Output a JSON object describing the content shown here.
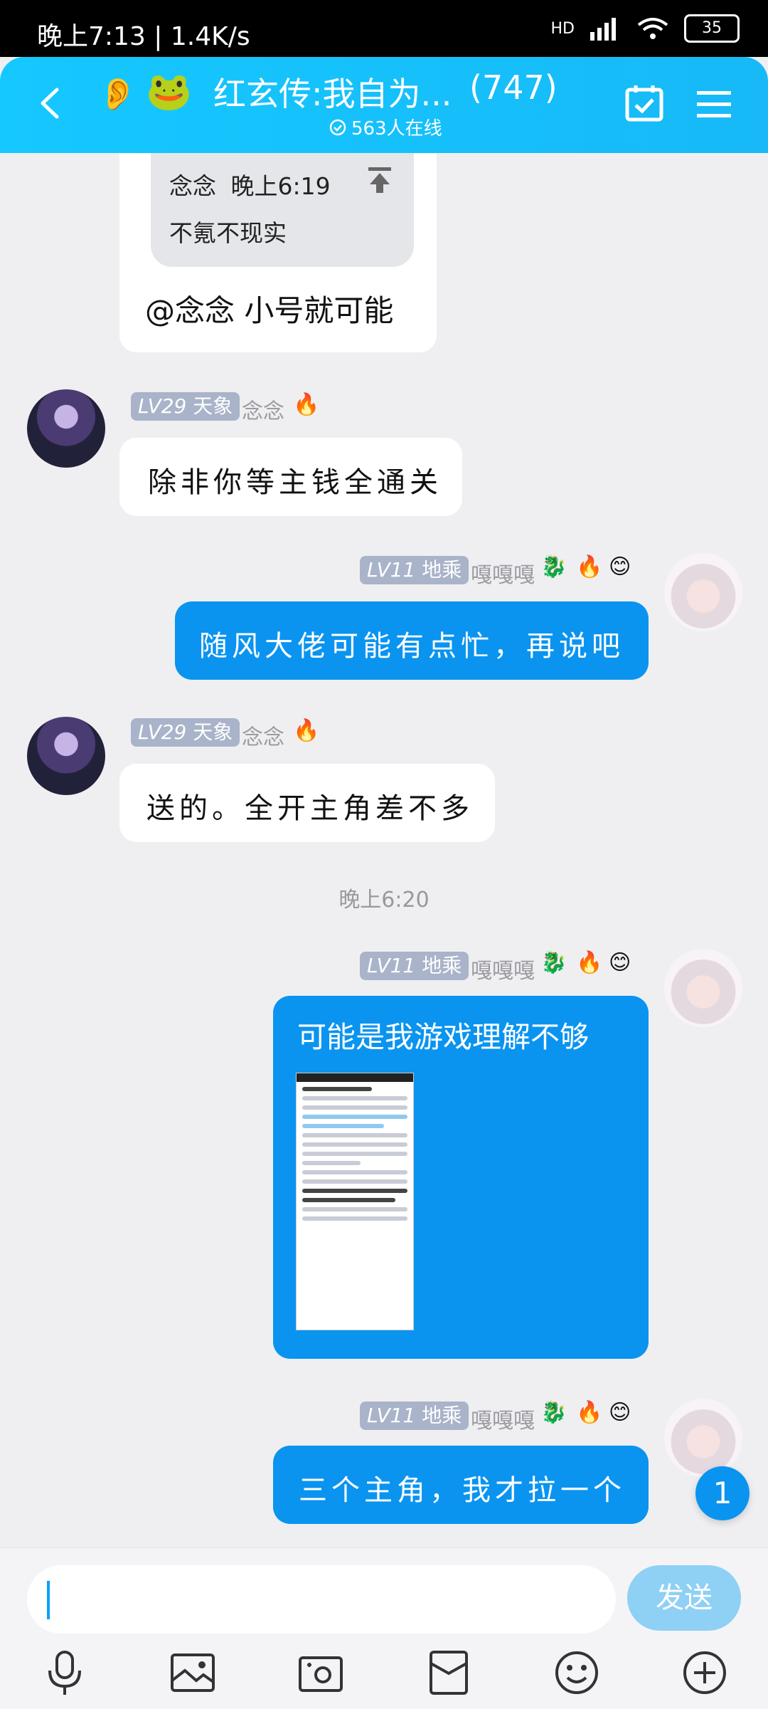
{
  "status_bar": {
    "time_speed": "晚上7:13 | 1.4K/s",
    "signal": "HD",
    "battery": "35"
  },
  "header": {
    "title": "红玄传:我自为...",
    "count": "(747)",
    "online": "563人在线"
  },
  "messages": {
    "m1": {
      "quote_author": "念念",
      "quote_time": "晚上6:19",
      "quote_text": "不氪不现实",
      "text": "@念念 小号就可能"
    },
    "m2": {
      "level": "LV29",
      "rank": "天象",
      "name": "念念",
      "text": "除非你等主钱全通关"
    },
    "m3": {
      "level": "LV11",
      "rank": "地乘",
      "name": "嘎嘎嘎",
      "text": "随风大佬可能有点忙，再说吧"
    },
    "m4": {
      "level": "LV29",
      "rank": "天象",
      "name": "念念",
      "text": "送的。全开主角差不多"
    },
    "time_separator": "晚上6:20",
    "m5": {
      "level": "LV11",
      "rank": "地乘",
      "name": "嘎嘎嘎",
      "text": "可能是我游戏理解不够"
    },
    "m6": {
      "level": "LV11",
      "rank": "地乘",
      "name": "嘎嘎嘎",
      "text": "三个主角，我才拉一个"
    }
  },
  "unread_count": "1",
  "input": {
    "placeholder": "",
    "send_label": "发送"
  }
}
